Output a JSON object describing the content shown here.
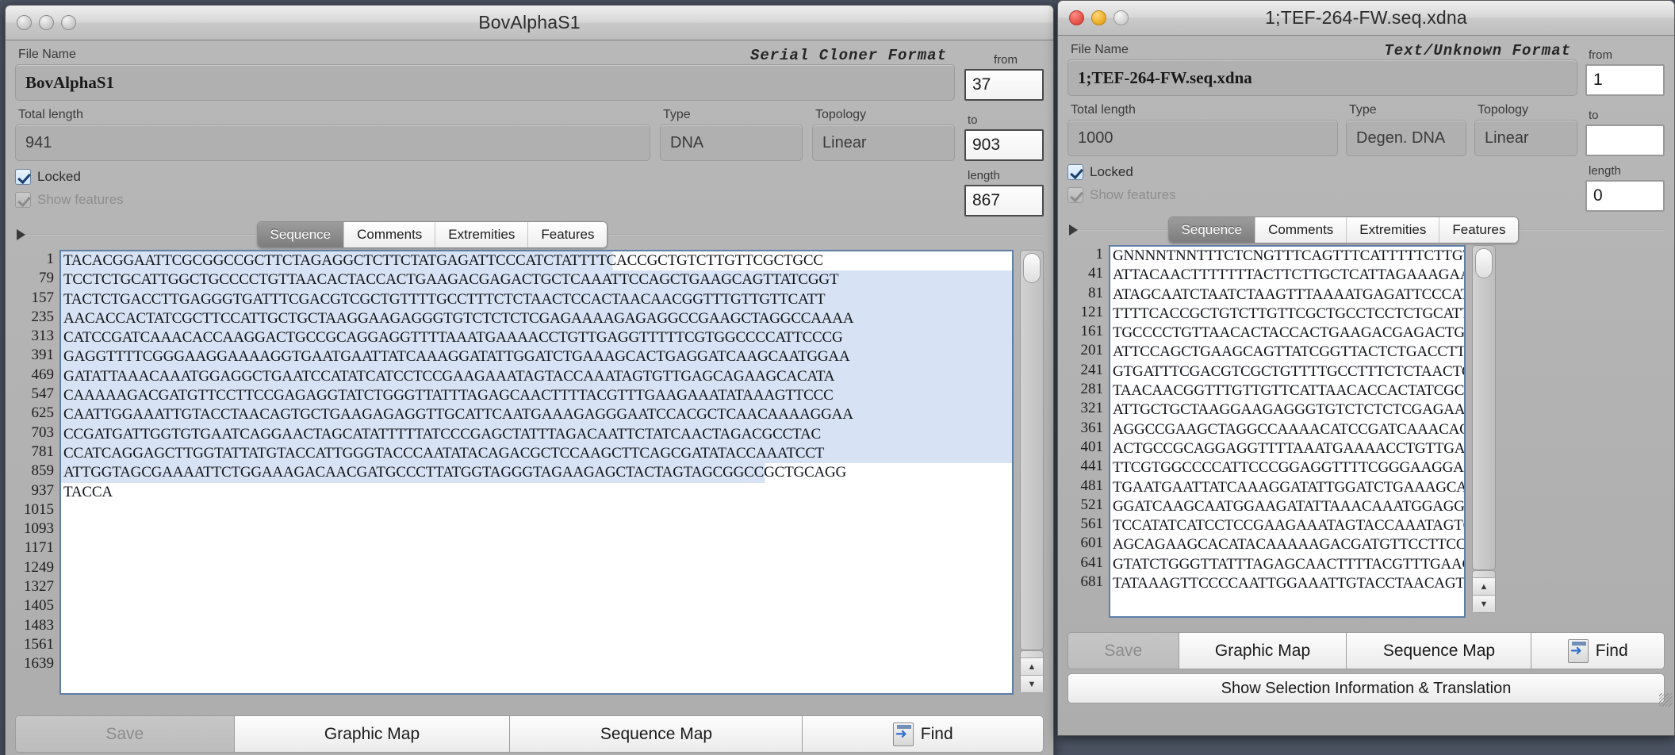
{
  "windows": {
    "left": {
      "title": "BovAlphaS1",
      "format_note": "Serial Cloner Format",
      "labels": {
        "file_name": "File Name",
        "total_length": "Total length",
        "type": "Type",
        "topology": "Topology",
        "from": "from",
        "to": "to",
        "length": "length",
        "locked": "Locked",
        "show_features": "Show features"
      },
      "fields": {
        "file_name": "BovAlphaS1",
        "total_length": "941",
        "type": "DNA",
        "topology": "Linear",
        "from": "37",
        "to": "903",
        "length": "867"
      },
      "checkboxes": {
        "locked": true,
        "show_features": true
      },
      "tabs": [
        {
          "label": "Sequence",
          "selected": true
        },
        {
          "label": "Comments",
          "selected": false
        },
        {
          "label": "Extremities",
          "selected": false
        },
        {
          "label": "Features",
          "selected": false
        }
      ],
      "sequence": {
        "line_numbers": [
          "1",
          "79",
          "157",
          "235",
          "313",
          "391",
          "469",
          "547",
          "625",
          "703",
          "781",
          "859",
          "937",
          "1015",
          "1093",
          "1171",
          "1249",
          "1327",
          "1405",
          "1483",
          "1561",
          "1639"
        ],
        "lines": [
          "TACACGGAATTCGCGGCCGCTTCTAGAGGCTCTTCTATGAGATTCCCATCTATTTTCACCGCTGTCTTGTTCGCTGCC",
          "TCCTCTGCATTGGCTGCCCCTGTTAACACTACCACTGAAGACGAGACTGCTCAAATTCCAGCTGAAGCAGTTATCGGT",
          "TACTCTGACCTTGAGGGTGATTTCGACGTCGCTGTTTTGCCTTTCTCTAACTCCACTAACAACGGTTTGTTGTTCATT",
          "AACACCACTATCGCTTCCATTGCTGCTAAGGAAGAGGGTGTCTCTCTCGAGAAAAGAGAGGCCGAAGCTAGGCCAAAA",
          "CATCCGATCAAACACCAAGGACTGCCGCAGGAGGTTTTAAATGAAAACCTGTTGAGGTTTTTCGTGGCCCCATTCCCG",
          "GAGGTTTTCGGGAAGGAAAAGGTGAATGAATTATCAAAGGATATTGGATCTGAAAGCACTGAGGATCAAGCAATGGAA",
          "GATATTAAACAAATGGAGGCTGAATCCATATCATCCTCCGAAGAAATAGTACCAAATAGTGTTGAGCAGAAGCACATA",
          "CAAAAAGACGATGTTCCTTCCGAGAGGTATCTGGGTTATTTAGAGCAACTTTTACGTTTGAAGAAATATAAAGTTCCC",
          "CAATTGGAAATTGTACCTAACAGTGCTGAAGAGAGGTTGCATTCAATGAAAGAGGGAATCCACGCTCAACAAAAGGAA",
          "CCGATGATTGGTGTGAATCAGGAACTAGCATATTTTTATCCCGAGCTATTTAGACAATTCTATCAACTAGACGCCTAC",
          "CCATCAGGAGCTTGGTATTATGTACCATTGGGTACCCAATATACAGACGCTCCAAGCTTCAGCGATATACCAAATCCT",
          "ATTGGTAGCGAAAATTCTGGAAAGACAACGATGCCCTTATGGTAGGGTAGAAGAGCTACTAGTAGCGGCCGCTGCAGG",
          "TACCA",
          "",
          "",
          "",
          "",
          "",
          "",
          "",
          "",
          ""
        ]
      },
      "buttons": {
        "save": "Save",
        "graphic_map": "Graphic Map",
        "sequence_map": "Sequence Map",
        "find": "Find"
      }
    },
    "right": {
      "title": "1;TEF-264-FW.seq.xdna",
      "format_note": "Text/Unknown Format",
      "labels": {
        "file_name": "File Name",
        "total_length": "Total length",
        "type": "Type",
        "topology": "Topology",
        "from": "from",
        "to": "to",
        "length": "length",
        "locked": "Locked",
        "show_features": "Show features"
      },
      "fields": {
        "file_name": "1;TEF-264-FW.seq.xdna",
        "total_length": "1000",
        "type": "Degen. DNA",
        "topology": "Linear",
        "from": "1",
        "to": "",
        "length": "0"
      },
      "checkboxes": {
        "locked": true,
        "show_features": true
      },
      "tabs": [
        {
          "label": "Sequence",
          "selected": true
        },
        {
          "label": "Comments",
          "selected": false
        },
        {
          "label": "Extremities",
          "selected": false
        },
        {
          "label": "Features",
          "selected": false
        }
      ],
      "sequence": {
        "line_numbers": [
          "1",
          "41",
          "81",
          "121",
          "161",
          "201",
          "241",
          "281",
          "321",
          "361",
          "401",
          "441",
          "481",
          "521",
          "561",
          "601",
          "641",
          "681"
        ],
        "lines": [
          "GNNNNTNNTTTCTCNGTTTCAGTTTCATTTTTCTTGTTCT",
          "ATTACAACTTTTTTTACTTCTTGCTCATTAGAAAGAAAGC",
          "ATAGCAATCTAATCTAAGTTTAAAATGAGATTCCCATCTA",
          "TTTTCACCGCTGTCTTGTTCGCTGCCTCCTCTGCATTGGC",
          "TGCCCCTGTTAACACTACCACTGAAGACGAGACTGCTCAA",
          "ATTCCAGCTGAAGCAGTTATCGGTTACTCTGACCTTGAGG",
          "GTGATTTCGACGTCGCTGTTTTGCCTTTCTCTAACTCCAC",
          "TAACAACGGTTTGTTGTTCATTAACACCACTATCGCTTCC",
          "ATTGCTGCTAAGGAAGAGGGTGTCTCTCTCGAGAAAAGAG",
          "AGGCCGAAGCTAGGCCAAAACATCCGATCAAACACCAAGG",
          "ACTGCCGCAGGAGGTTTTAAATGAAAACCTGTTGAGGTTT",
          "TTCGTGGCCCCATTCCCGGAGGTTTTCGGGAAGGAAAAGG",
          "TGAATGAATTATCAAAGGATATTGGATCTGAAAGCACTGA",
          "GGATCAAGCAATGGAAGATATTAAACAAATGGAGGCTGAA",
          "TCCATATCATCCTCCGAAGAAATAGTACCAAATAGTGTTG",
          "AGCAGAAGCACATACAAAAAGACGATGTTCCTTCCGAGAG",
          "GTATCTGGGTTATTTAGAGCAACTTTTACGTTTGAAGAAA",
          "TATAAAGTTCCCCAATTGGAAATTGTACCTAACAGTGCTG"
        ]
      },
      "buttons": {
        "save": "Save",
        "graphic_map": "Graphic Map",
        "sequence_map": "Sequence Map",
        "find": "Find",
        "show_selection": "Show Selection Information & Translation"
      }
    }
  },
  "colors": {
    "desktop": "#4b5261",
    "window_bg": "#b4b4b4",
    "selection": "#d7e3f4",
    "seq_border": "#5e7fa8"
  }
}
